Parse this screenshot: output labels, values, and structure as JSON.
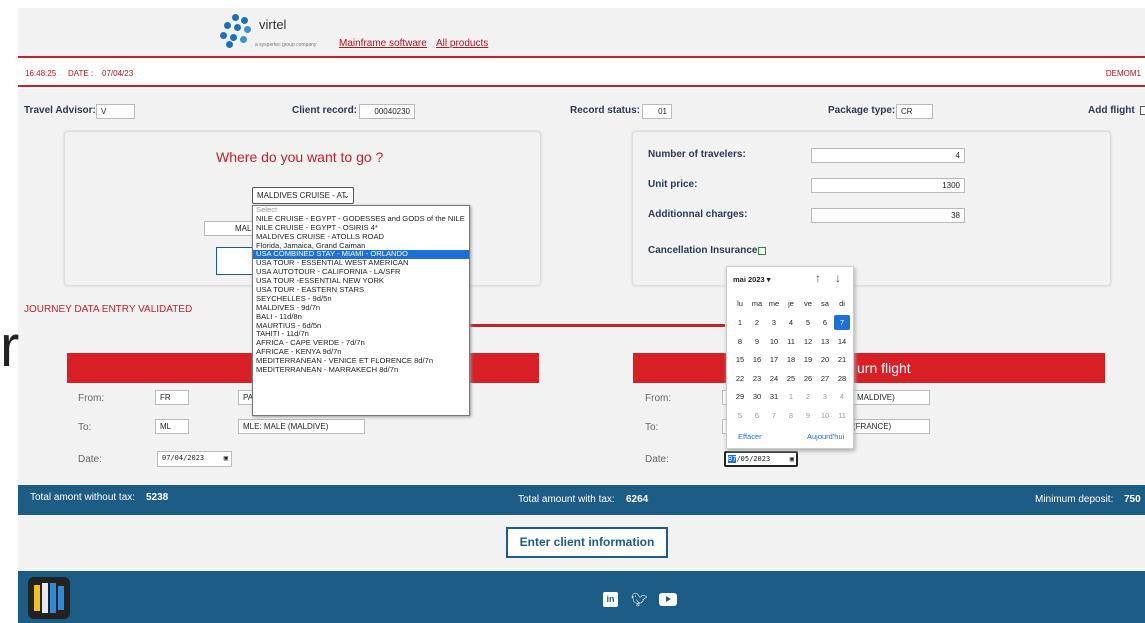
{
  "header": {
    "brand": "virtel",
    "brand_sub": "a syspertec group company",
    "link_mainframe": "Mainframe software",
    "link_products": "All products"
  },
  "infobar": {
    "time": "16:48:25",
    "date_label": "DATE :",
    "date_value": "07/04/23",
    "user": "DEMOM1"
  },
  "fields": {
    "travel_advisor_label": "Travel Advisor:",
    "travel_advisor_value": "V",
    "client_record_label": "Client record:",
    "client_record_value": "00040230",
    "record_status_label": "Record status:",
    "record_status_value": "01",
    "package_type_label": "Package type:",
    "package_type_value": "CR",
    "add_flight_label": "Add flight"
  },
  "destination": {
    "title": "Where do you want to go ?",
    "selected": "MALDIVES CRUISE - AT",
    "city_partial": "MAL",
    "options": [
      "Select",
      "NILE CRUISE - EGYPT - GODESSES and GODS of the NILE",
      "NILE CRUISE - EGYPT - OSIRIS 4*",
      "MALDIVES CRUISE - ATOLLS ROAD",
      "Florida, Jamaica, Grand Caiman",
      "USA COMBINED STAY - MIAMI - ORLANDO",
      "USA TOUR - ESSENTIAL WEST AMERICAN",
      "USA AUTOTOUR - CALIFORNIA - LA/SFR",
      "USA TOUR -ESSENTIAL NEW YORK",
      "USA TOUR - EASTERN STARS",
      "SEYCHELLES - 9d/5n",
      "MALDIVES - 9d/7n",
      "BALI - 11d/8n",
      "MAURTIUS - 6d/5n",
      "TAHITI - 11d/7n",
      "AFRICA - CAPE VERDE - 7d/7n",
      "AFRICAE - KENYA 9d/7n",
      "MEDITERRANEAN - VENICE ET FLORENCE 8d/7n",
      "MEDITERRANEAN - MARRAKECH 8d/7n"
    ],
    "highlighted_index": 5
  },
  "pricing": {
    "travelers_label": "Number of travelers:",
    "travelers_value": "4",
    "unit_price_label": "Unit price:",
    "unit_price_value": "1300",
    "charges_label": "Additionnal charges:",
    "charges_value": "38",
    "cancellation_label": "Cancellation Insurance"
  },
  "status_message": "JOURNEY DATA ENTRY VALIDATED",
  "outbound": {
    "from_label": "From:",
    "from_code": "FR",
    "from_city": "PA",
    "to_label": "To:",
    "to_code": "ML",
    "to_city": "MLE: MALE (MALDIVE)",
    "date_label": "Date:",
    "date_value": "07/04/2023"
  },
  "return_flight": {
    "title": "urn flight",
    "from_label": "From:",
    "from_city": "MALDIVE)",
    "to_label": "To:",
    "to_city": "(FRANCE)",
    "date_label": "Date:",
    "date_day": "07",
    "date_rest": "/05/2023"
  },
  "calendar": {
    "month": "mai 2023 ▾",
    "weekdays": [
      "lu",
      "ma",
      "me",
      "je",
      "ve",
      "sa",
      "di"
    ],
    "weeks": [
      [
        "1",
        "2",
        "3",
        "4",
        "5",
        "6",
        "7"
      ],
      [
        "8",
        "9",
        "10",
        "11",
        "12",
        "13",
        "14"
      ],
      [
        "15",
        "16",
        "17",
        "18",
        "19",
        "20",
        "21"
      ],
      [
        "22",
        "23",
        "24",
        "25",
        "26",
        "27",
        "28"
      ],
      [
        "29",
        "30",
        "31",
        "1",
        "2",
        "3",
        "4"
      ],
      [
        "5",
        "6",
        "7",
        "8",
        "9",
        "10",
        "11"
      ]
    ],
    "clear_label": "Effacer",
    "today_label": "Aujourd'hui"
  },
  "totals": {
    "without_tax_label": "Total amont without tax:",
    "without_tax_value": "5238",
    "with_tax_label": "Total amount with tax:",
    "with_tax_value": "6264",
    "deposit_label": "Minimum deposit:",
    "deposit_value": "750"
  },
  "actions": {
    "enter_client": "Enter client information"
  },
  "colors": {
    "accent_red": "#c0232b",
    "brand_blue": "#1d5c84",
    "selection_blue": "#1e70d6"
  }
}
